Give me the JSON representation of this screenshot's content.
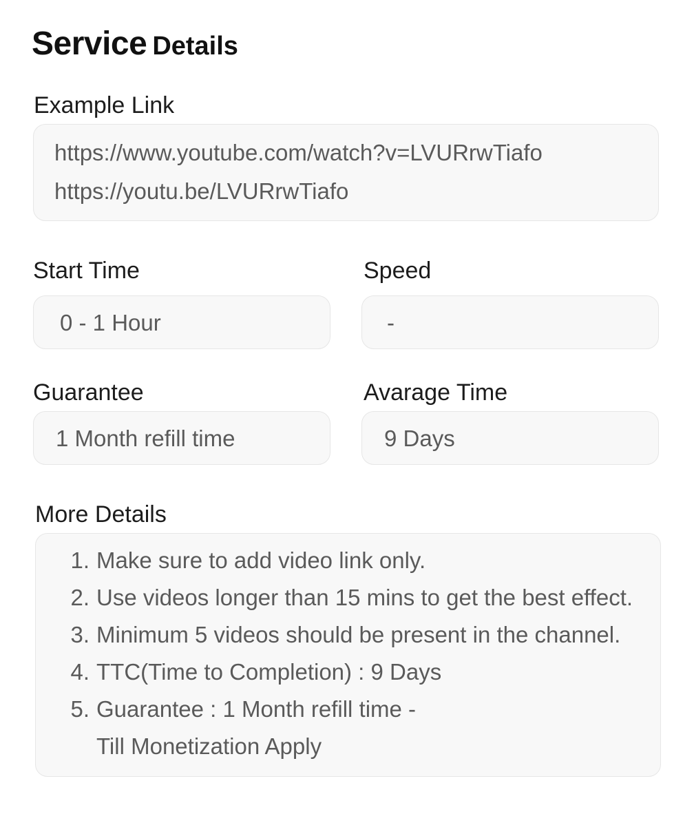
{
  "header": {
    "title_main": "Service",
    "title_rest": "Details"
  },
  "example_link": {
    "label": "Example Link",
    "lines": [
      "https://www.youtube.com/watch?v=LVURrwTiafo",
      "https://youtu.be/LVURrwTiafo"
    ]
  },
  "start_time": {
    "label": "Start Time",
    "value": "0 - 1 Hour"
  },
  "speed": {
    "label": "Speed",
    "value": "-"
  },
  "guarantee": {
    "label": "Guarantee",
    "value": "1 Month refill time"
  },
  "average_time": {
    "label": "Avarage Time",
    "value": "9 Days"
  },
  "more_details": {
    "label": "More Details",
    "items": [
      {
        "num": "1.",
        "lines": [
          "Make sure to add video link only."
        ]
      },
      {
        "num": "2.",
        "lines": [
          "Use videos longer than 15 mins to get the best effect."
        ]
      },
      {
        "num": "3.",
        "lines": [
          "Minimum 5 videos should be present in the channel."
        ]
      },
      {
        "num": "4.",
        "lines": [
          "TTC(Time to Completion) : 9 Days"
        ]
      },
      {
        "num": "5.",
        "lines": [
          "Guarantee : 1 Month refill time -",
          "Till Monetization Apply"
        ]
      }
    ]
  }
}
